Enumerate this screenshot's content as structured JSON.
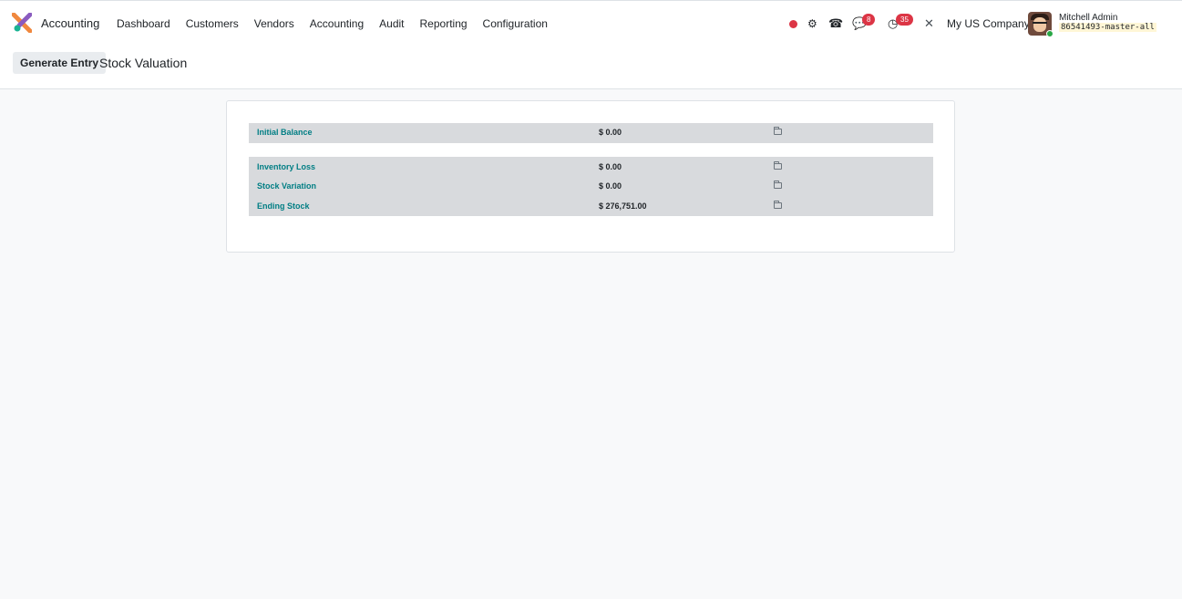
{
  "navbar": {
    "app_name": "Accounting",
    "menu": [
      "Dashboard",
      "Customers",
      "Vendors",
      "Accounting",
      "Audit",
      "Reporting",
      "Configuration"
    ],
    "chat_badge": "8",
    "activity_badge": "35",
    "company": "My US Company",
    "user_name": "Mitchell Admin",
    "db_name": "86541493-master-all"
  },
  "control_panel": {
    "generate_label": "Generate Entry",
    "title": "Stock Valuation"
  },
  "report": {
    "initial": {
      "label": "Initial Balance",
      "value": "$ 0.00"
    },
    "rows": [
      {
        "label": "Inventory Loss",
        "value": "$ 0.00"
      },
      {
        "label": "Stock Variation",
        "value": "$ 0.00"
      },
      {
        "label": "Ending Stock",
        "value": "$ 276,751.00"
      }
    ]
  },
  "colors": {
    "accent": "#017e84",
    "badge": "#dc3545"
  }
}
